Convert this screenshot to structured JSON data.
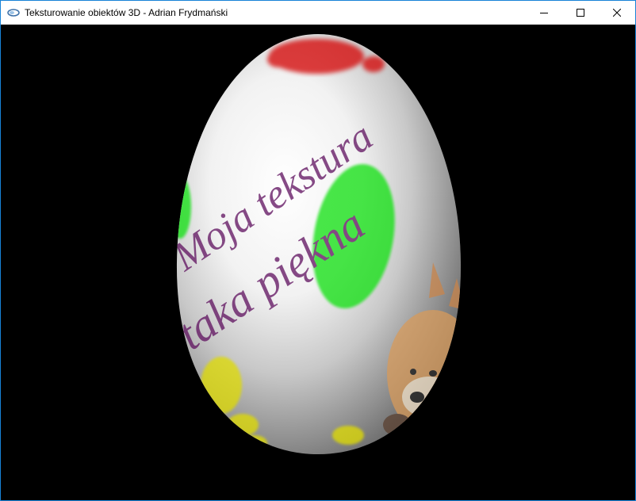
{
  "window": {
    "title": "Teksturowanie obiektów 3D - Adrian Frydmański",
    "icon": "opengl-app-icon",
    "controls": {
      "minimize_icon": "minimize-icon",
      "maximize_icon": "maximize-icon",
      "close_icon": "close-icon"
    }
  },
  "scene": {
    "background_color": "#000000",
    "object": "textured-egg",
    "texture_text_line1": "Moja tekstura",
    "texture_text_line2": "taka piękna",
    "colors": {
      "text": "#5e0f5e",
      "green_spot": "#0fe010",
      "red_splash": "#d40000",
      "yellow_splash": "#e0dc00"
    }
  }
}
